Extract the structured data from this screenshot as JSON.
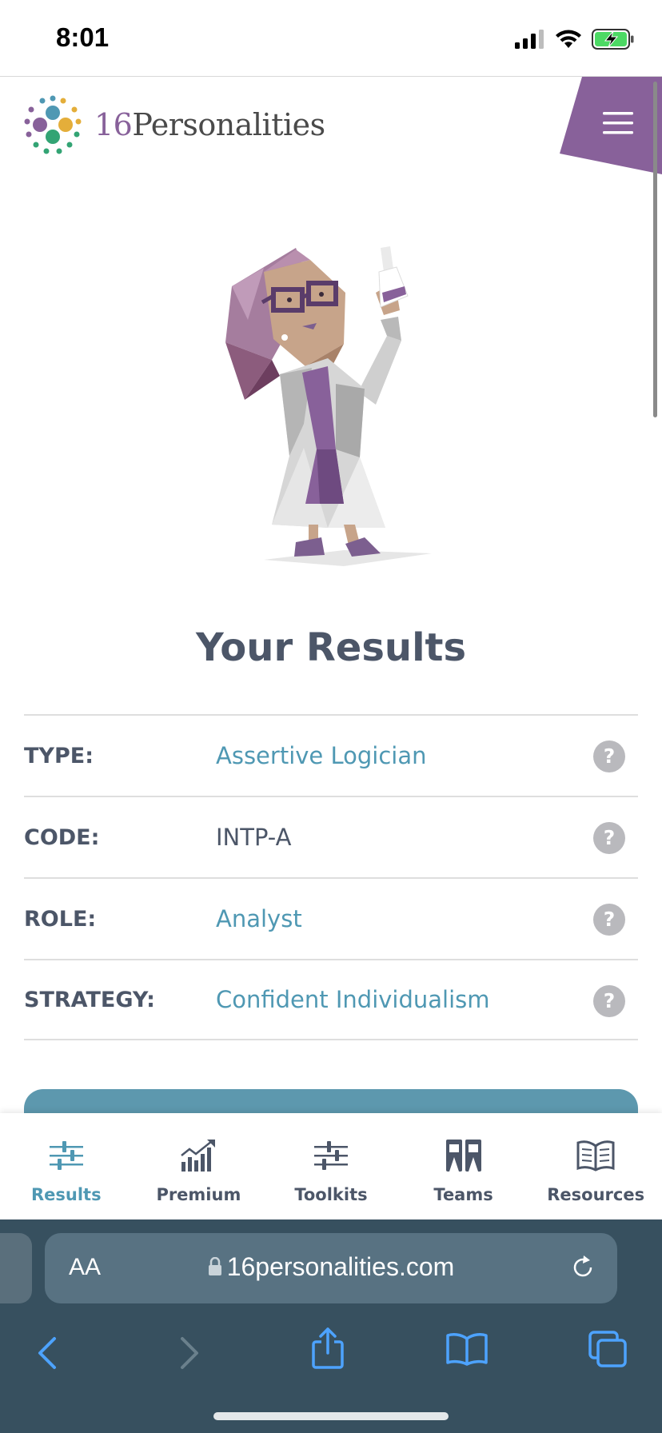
{
  "status_bar": {
    "time": "8:01",
    "icons": [
      "cellular-signal-icon",
      "wifi-icon",
      "battery-charging-icon"
    ]
  },
  "header": {
    "logo_number": "16",
    "logo_text": "Personalities",
    "menu_icon": "hamburger-menu-icon",
    "brand_color": "#88619a"
  },
  "hero": {
    "illustration": "logician-scientist-illustration"
  },
  "results": {
    "title": "Your Results",
    "rows": [
      {
        "label": "TYPE:",
        "value": "Assertive Logician",
        "help": "?"
      },
      {
        "label": "CODE:",
        "value": "INTP-A",
        "help": "?"
      },
      {
        "label": "ROLE:",
        "value": "Analyst",
        "help": "?"
      },
      {
        "label": "STRATEGY:",
        "value": "Confident Individualism",
        "help": "?"
      }
    ],
    "link_color": "#4f98b3"
  },
  "bottom_nav": {
    "items": [
      {
        "label": "Results",
        "icon": "sliders-icon",
        "active": true
      },
      {
        "label": "Premium",
        "icon": "growth-chart-icon",
        "active": false
      },
      {
        "label": "Toolkits",
        "icon": "sliders-icon",
        "active": false
      },
      {
        "label": "Teams",
        "icon": "team-portraits-icon",
        "active": false
      },
      {
        "label": "Resources",
        "icon": "open-book-icon",
        "active": false
      }
    ]
  },
  "browser": {
    "text_size_label": "AA",
    "url": "16personalities.com",
    "toolbar": [
      "back-icon",
      "forward-icon",
      "share-icon",
      "bookmarks-icon",
      "tabs-icon"
    ]
  }
}
